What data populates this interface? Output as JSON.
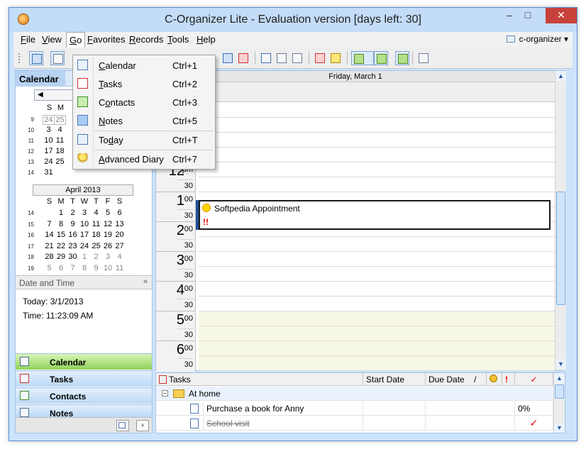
{
  "window": {
    "title": "C-Organizer Lite - Evaluation version [days left: 30]",
    "controls": {
      "minimize": "–",
      "maximize": "□",
      "close": "✕"
    }
  },
  "menubar": {
    "items": [
      {
        "key": "F",
        "rest": "ile"
      },
      {
        "key": "V",
        "rest": "iew"
      },
      {
        "key": "G",
        "rest": "o"
      },
      {
        "key": "F",
        "rest": "avorites"
      },
      {
        "key": "R",
        "rest": "ecords"
      },
      {
        "key": "T",
        "rest": "ools"
      },
      {
        "key": "H",
        "rest": "elp"
      }
    ],
    "profile": "c-organizer ▾"
  },
  "go_menu": {
    "items": [
      {
        "label_key": "C",
        "label_rest": "alendar",
        "shortcut": "Ctrl+1",
        "icon": "calendar-icon"
      },
      {
        "label_key": "T",
        "label_rest": "asks",
        "shortcut": "Ctrl+2",
        "icon": "tasks-icon"
      },
      {
        "label_pre": "C",
        "label_key": "o",
        "label_rest": "ntacts",
        "shortcut": "Ctrl+3",
        "icon": "contacts-icon"
      },
      {
        "label_key": "N",
        "label_rest": "otes",
        "shortcut": "Ctrl+5",
        "icon": "notes-icon"
      },
      {
        "label_pre": "To",
        "label_key": "d",
        "label_rest": "ay",
        "shortcut": "Ctrl+T",
        "icon": "today-icon"
      },
      {
        "label_key": "A",
        "label_rest": "dvanced Diary",
        "shortcut": "Ctrl+7",
        "icon": "diary-icon"
      }
    ]
  },
  "left_panel": {
    "header_label": "Calendar",
    "march": {
      "dow": [
        "S",
        "M"
      ],
      "weeks": [
        {
          "wk": "9",
          "days": [
            "",
            "24",
            "25"
          ]
        },
        {
          "wk": "10",
          "days": [
            "3",
            "4"
          ]
        },
        {
          "wk": "11",
          "days": [
            "10",
            "11"
          ]
        },
        {
          "wk": "12",
          "days": [
            "17",
            "18"
          ]
        },
        {
          "wk": "13",
          "days": [
            "24",
            "25"
          ]
        },
        {
          "wk": "14",
          "days": [
            "31"
          ]
        }
      ]
    },
    "april": {
      "title": "April 2013",
      "dow": [
        "S",
        "M",
        "T",
        "W",
        "T",
        "F",
        "S"
      ],
      "weeks": [
        {
          "wk": "14",
          "days": [
            "",
            "1",
            "2",
            "3",
            "4",
            "5",
            "6"
          ]
        },
        {
          "wk": "15",
          "days": [
            "7",
            "8",
            "9",
            "10",
            "11",
            "12",
            "13"
          ]
        },
        {
          "wk": "16",
          "days": [
            "14",
            "15",
            "16",
            "17",
            "18",
            "19",
            "20"
          ]
        },
        {
          "wk": "17",
          "days": [
            "21",
            "22",
            "23",
            "24",
            "25",
            "26",
            "27"
          ]
        },
        {
          "wk": "18",
          "days": [
            "28",
            "29",
            "30",
            "1",
            "2",
            "3",
            "4"
          ]
        },
        {
          "wk": "19",
          "days": [
            "5",
            "6",
            "7",
            "8",
            "9",
            "10",
            "11"
          ]
        }
      ]
    },
    "date_time": {
      "header": "Date and Time",
      "today": "Today: 3/1/2013",
      "time": "Time: 11:23:09 AM"
    },
    "nav_buttons": [
      "Calendar",
      "Tasks",
      "Contacts",
      "Notes"
    ]
  },
  "day_view": {
    "header": "Friday, March 1",
    "hours": [
      {
        "h": "12",
        "suffix": "pm",
        "half": "30"
      },
      {
        "h": "1",
        "suffix": "00",
        "half": "30"
      },
      {
        "h": "2",
        "suffix": "00",
        "half": "30"
      },
      {
        "h": "3",
        "suffix": "00",
        "half": "30"
      },
      {
        "h": "4",
        "suffix": "00",
        "half": "30"
      },
      {
        "h": "5",
        "suffix": "00",
        "half": "30"
      },
      {
        "h": "6",
        "suffix": "00",
        "half": "30"
      }
    ],
    "appointment": {
      "title": "Softpedia Appointment",
      "priority": "!!"
    }
  },
  "tasks_panel": {
    "columns": [
      "Tasks",
      "Start Date",
      "Due Date",
      "/",
      "",
      "!",
      "✓"
    ],
    "group": "At home",
    "rows": [
      {
        "name": "Purchase a book for Anny",
        "progress": "0%",
        "done": ""
      },
      {
        "name": "School visit",
        "progress": "",
        "done": "✓"
      }
    ]
  }
}
